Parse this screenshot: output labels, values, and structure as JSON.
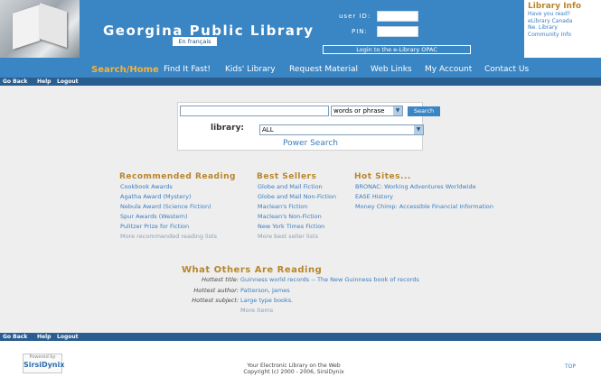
{
  "header": {
    "title": "Georgina Public Library",
    "lang_button": "En français",
    "user_id_label": "user ID:",
    "pin_label": "PIN:",
    "login_button": "Login to the e-Library OPAC",
    "info_title": "Library Info",
    "info_links": [
      "Have you read?",
      "eLibrary Canada",
      "Ne. Library",
      "Community Info"
    ]
  },
  "nav": {
    "items": [
      "Search/Home",
      "Find It Fast!",
      "Kids' Library",
      "Request Material",
      "Web Links",
      "My Account",
      "Contact Us"
    ]
  },
  "subnav": [
    "Go Back",
    "Help",
    "Logout"
  ],
  "search": {
    "mode": "words or phrase",
    "button": "Search",
    "library_label": "library:",
    "library_value": "ALL",
    "power_search": "Power Search"
  },
  "recommended": {
    "title": "Recommended Reading",
    "links": [
      "Cookbook Awards",
      "Agatha Award (Mystery)",
      "Nebula Award (Science Fiction)",
      "Spur Awards (Western)",
      "Pulitzer Prize for Fiction"
    ],
    "more": "More recommended reading lists"
  },
  "bestsellers": {
    "title": "Best Sellers",
    "links": [
      "Globe and Mail Fiction",
      "Globe and Mail Non-Fiction",
      "Maclean's Fiction",
      "Maclean's Non-Fiction",
      "New York Times Fiction"
    ],
    "more": "More best seller lists"
  },
  "hotsites": {
    "title": "Hot Sites...",
    "links": [
      "BRONAC: Working Adventures Worldwide",
      "EASE History",
      "Money Chimp: Accessible Financial Information"
    ]
  },
  "others": {
    "title": "What Others Are Reading",
    "rows": [
      {
        "label": "Hottest title:",
        "value": "Guinness world records -- The New Guinness book of records"
      },
      {
        "label": "Hottest author:",
        "value": "Patterson, James"
      },
      {
        "label": "Hottest subject:",
        "value": "Large type books."
      }
    ],
    "more": "More items"
  },
  "footer": {
    "powered_by": "Powered by",
    "brand": "SirsiDynix",
    "line1": "Your Electronic Library on the Web",
    "line2": "Copyright (c) 2000 - 2006, SirsiDynix",
    "top": "TOP"
  }
}
